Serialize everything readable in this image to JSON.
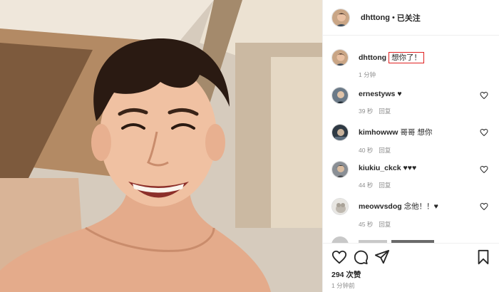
{
  "post": {
    "username": "dhttong",
    "separator": "•",
    "follow_status": "已关注",
    "caption": "想你了！",
    "caption_time": "1 分钟",
    "likes": "294 次赞",
    "posted_time": "1 分钟前"
  },
  "comments": [
    {
      "username": "ernestyws",
      "text": "♥",
      "time": "39 秒",
      "reply": "回复"
    },
    {
      "username": "kimhowww",
      "text": "哥哥 想你",
      "time": "40 秒",
      "reply": "回复"
    },
    {
      "username": "kiukiu_ckck",
      "text": "♥♥♥",
      "time": "44 秒",
      "reply": "回复"
    },
    {
      "username": "meowvsdog",
      "text": "念他！！♥",
      "time": "45 秒",
      "reply": "回复"
    }
  ],
  "icons": {
    "like": "heart-outline-icon",
    "comment": "speech-bubble-icon",
    "share": "paper-plane-icon",
    "save": "bookmark-icon"
  },
  "colors": {
    "highlight_box": "#e02020",
    "meta_text": "#8e8e8e",
    "divider": "#efefef"
  }
}
